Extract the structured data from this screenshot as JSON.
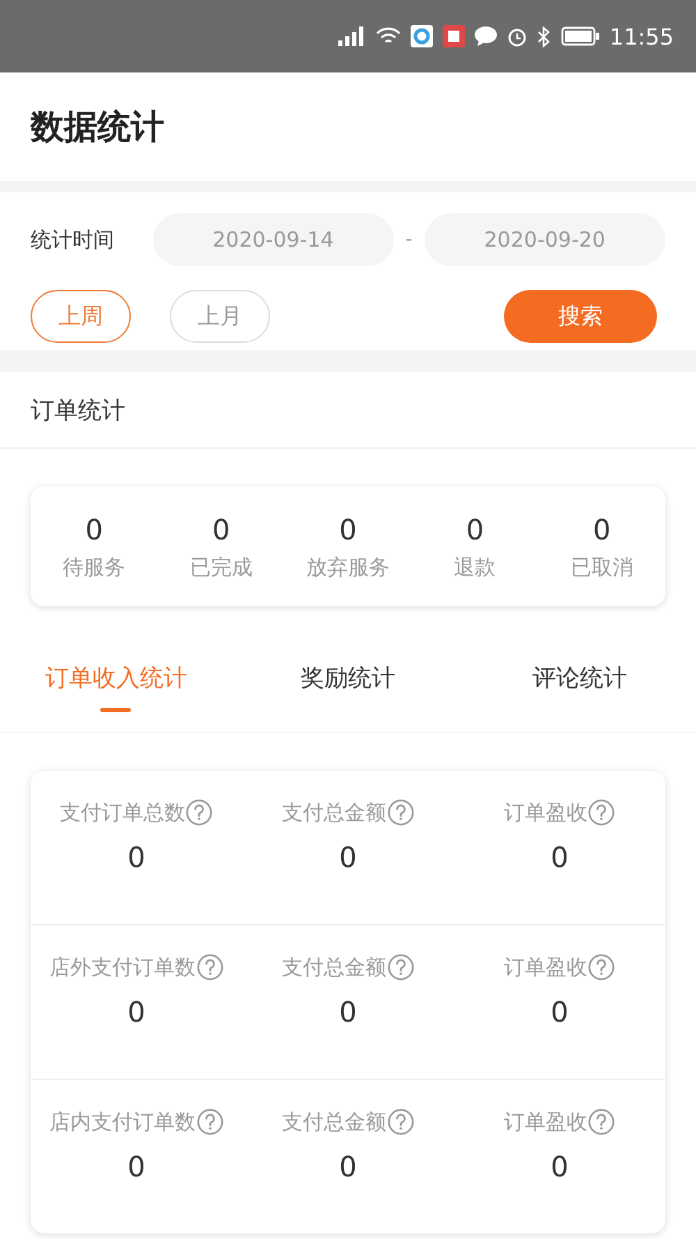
{
  "status_bar": {
    "time": "11:55"
  },
  "header": {
    "title": "数据统计"
  },
  "filter": {
    "label": "统计时间",
    "start_date": "2020-09-14",
    "separator": "-",
    "end_date": "2020-09-20",
    "quick_ranges": [
      {
        "label": "上周",
        "selected": true
      },
      {
        "label": "上月",
        "selected": false
      }
    ],
    "search_button": "搜索"
  },
  "order_stats": {
    "title": "订单统计",
    "items": [
      {
        "value": "0",
        "label": "待服务"
      },
      {
        "value": "0",
        "label": "已完成"
      },
      {
        "value": "0",
        "label": "放弃服务"
      },
      {
        "value": "0",
        "label": "退款"
      },
      {
        "value": "0",
        "label": "已取消"
      }
    ]
  },
  "tabs": [
    {
      "label": "订单收入统计",
      "selected": true
    },
    {
      "label": "奖励统计",
      "selected": false
    },
    {
      "label": "评论统计",
      "selected": false
    }
  ],
  "income_stats": {
    "rows": [
      [
        {
          "label": "支付订单总数",
          "value": "0"
        },
        {
          "label": "支付总金额",
          "value": "0"
        },
        {
          "label": "订单盈收",
          "value": "0"
        }
      ],
      [
        {
          "label": "店外支付订单数",
          "value": "0"
        },
        {
          "label": "支付总金额",
          "value": "0"
        },
        {
          "label": "订单盈收",
          "value": "0"
        }
      ],
      [
        {
          "label": "店内支付订单数",
          "value": "0"
        },
        {
          "label": "支付总金额",
          "value": "0"
        },
        {
          "label": "订单盈收",
          "value": "0"
        }
      ]
    ]
  }
}
